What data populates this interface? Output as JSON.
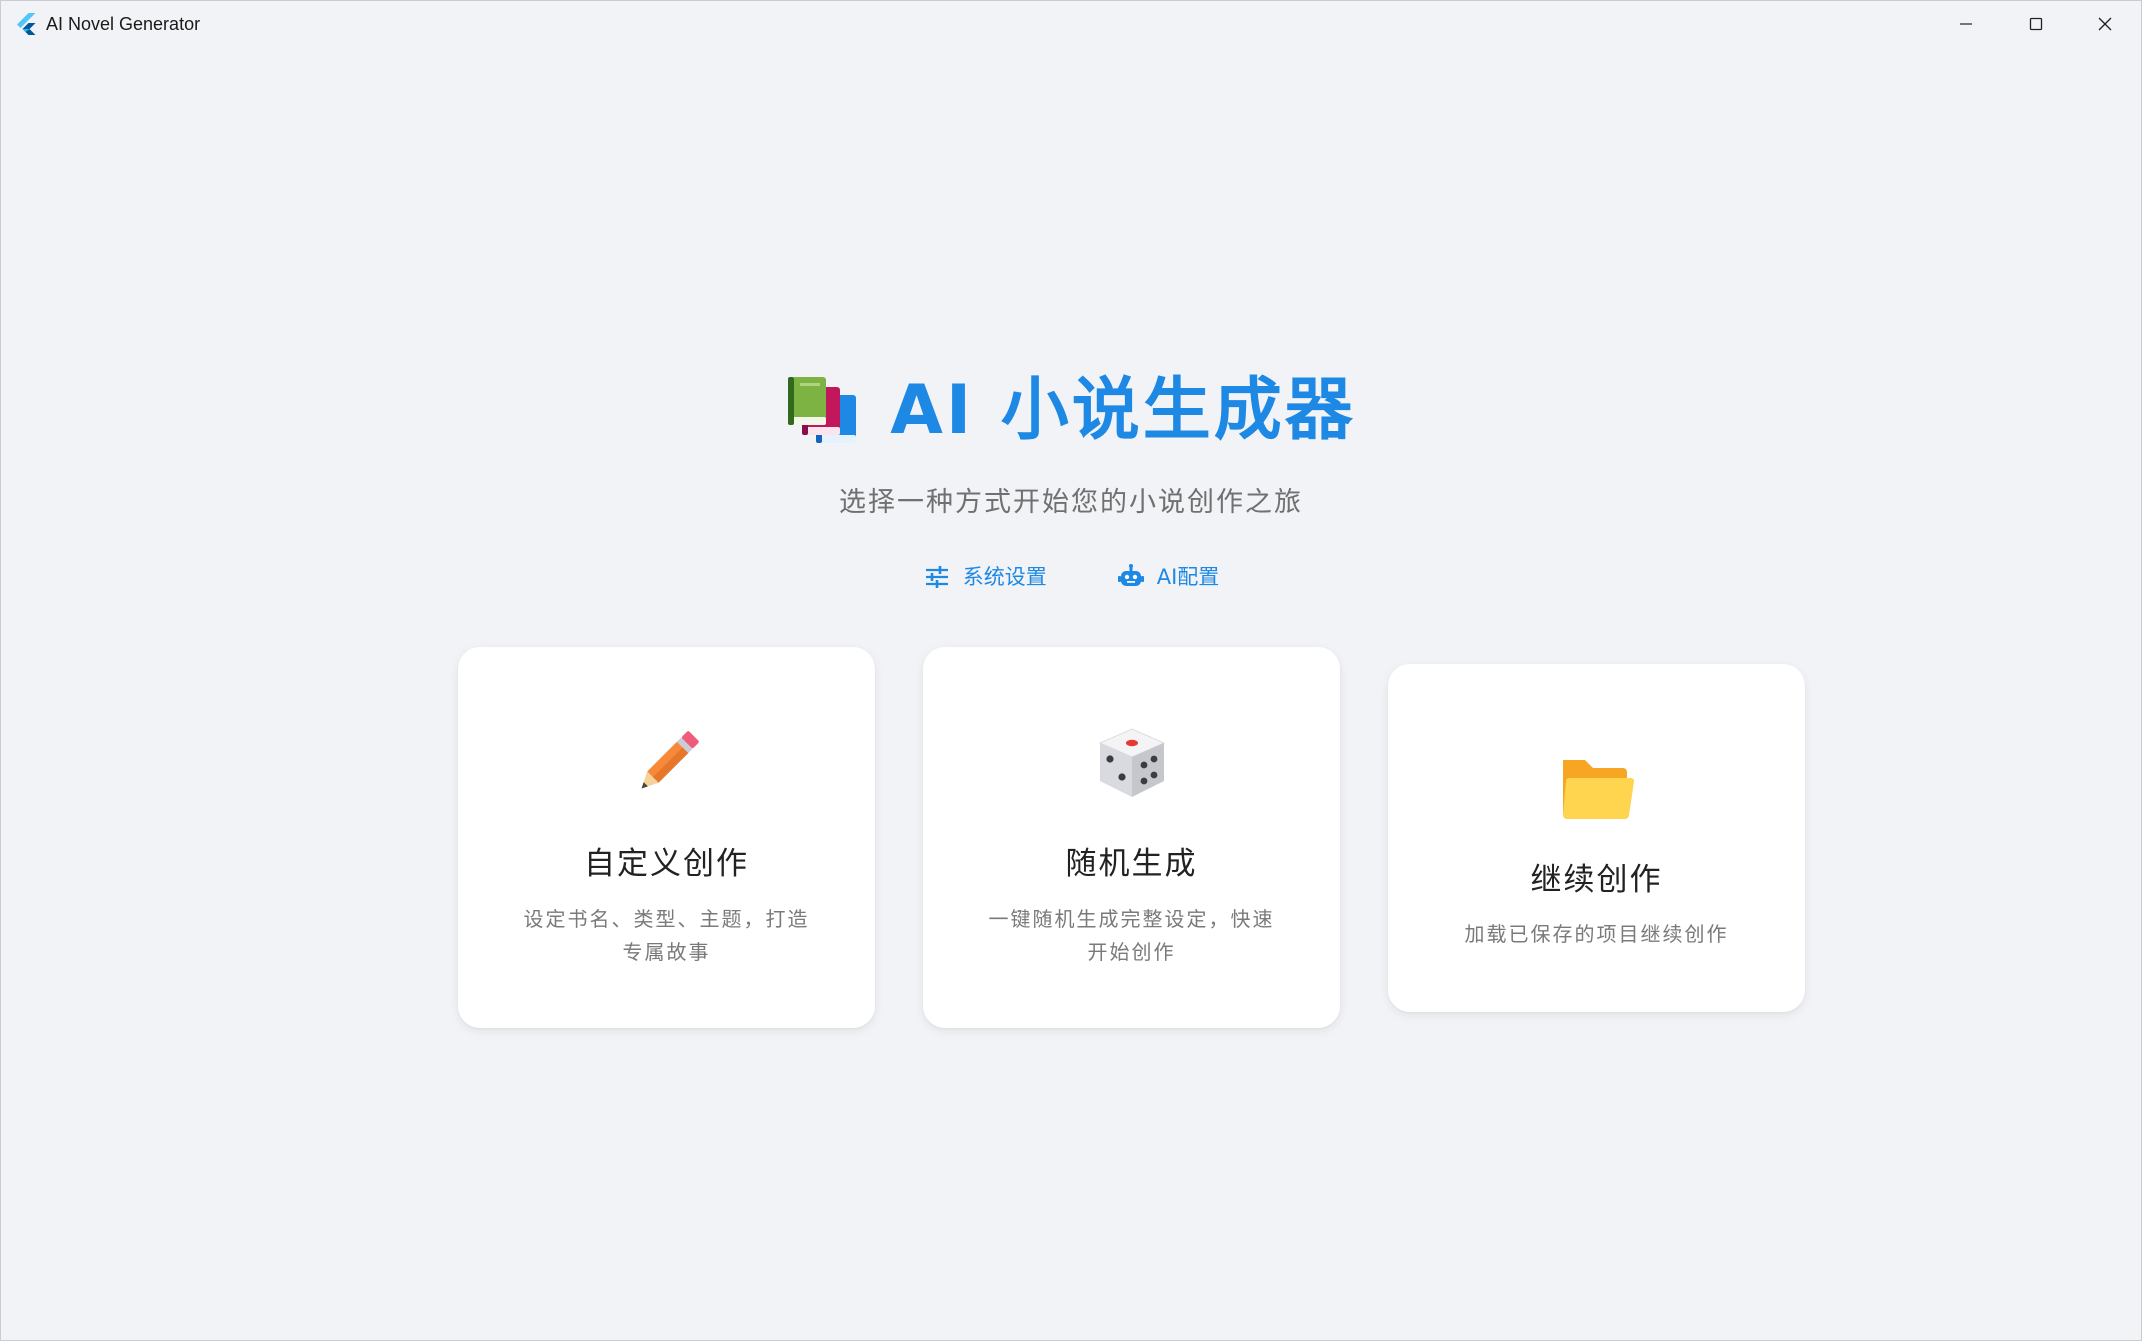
{
  "window": {
    "title": "AI Novel Generator",
    "icon": "flutter-logo-icon",
    "controls": [
      "minimize-icon",
      "maximize-icon",
      "close-icon"
    ]
  },
  "hero": {
    "icon": "books-icon",
    "title": "AI 小说生成器",
    "subtitle": "选择一种方式开始您的小说创作之旅"
  },
  "links": [
    {
      "icon": "sliders-icon",
      "label": "系统设置"
    },
    {
      "icon": "robot-icon",
      "label": "AI配置"
    }
  ],
  "cards": [
    {
      "icon": "pencil-icon",
      "title": "自定义创作",
      "description": "设定书名、类型、主题，打造专属故事"
    },
    {
      "icon": "dice-icon",
      "title": "随机生成",
      "description": "一键随机生成完整设定，快速开始创作"
    },
    {
      "icon": "folder-icon",
      "title": "继续创作",
      "description": "加载已保存的项目继续创作"
    }
  ],
  "colors": {
    "accent": "#1e88e5",
    "background": "#f1f3f6",
    "card": "#ffffff"
  }
}
